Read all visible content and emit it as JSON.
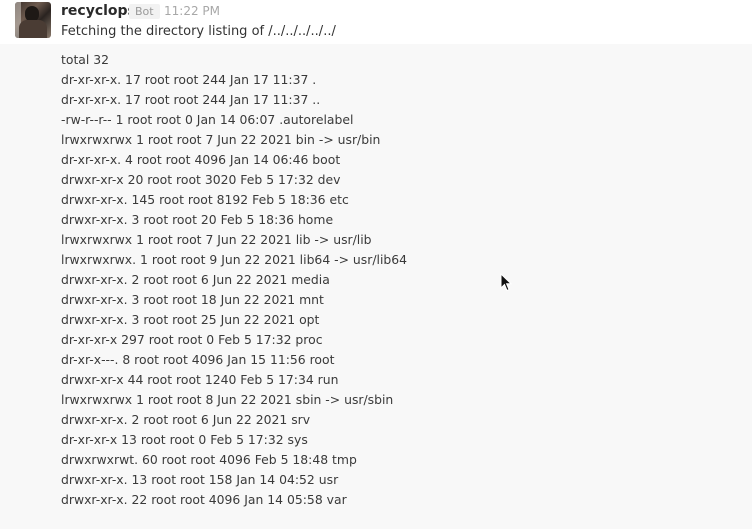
{
  "message": {
    "sender": "recyclops",
    "badge": "Bot",
    "timestamp": "11:22 PM",
    "text": "Fetching the directory listing of /../../../../../",
    "avatar_icon": "avatar-image"
  },
  "listing": [
    "total 32",
    "dr-xr-xr-x. 17 root root 244 Jan 17 11:37 .",
    "dr-xr-xr-x. 17 root root 244 Jan 17 11:37 ..",
    "-rw-r--r-- 1 root root 0 Jan 14 06:07 .autorelabel",
    "lrwxrwxrwx 1 root root 7 Jun 22 2021 bin -> usr/bin",
    "dr-xr-xr-x. 4 root root 4096 Jan 14 06:46 boot",
    "drwxr-xr-x 20 root root 3020 Feb 5 17:32 dev",
    "drwxr-xr-x. 145 root root 8192 Feb 5 18:36 etc",
    "drwxr-xr-x. 3 root root 20 Feb 5 18:36 home",
    "lrwxrwxrwx 1 root root 7 Jun 22 2021 lib -> usr/lib",
    "lrwxrwxrwx. 1 root root 9 Jun 22 2021 lib64 -> usr/lib64",
    "drwxr-xr-x. 2 root root 6 Jun 22 2021 media",
    "drwxr-xr-x. 3 root root 18 Jun 22 2021 mnt",
    "drwxr-xr-x. 3 root root 25 Jun 22 2021 opt",
    "dr-xr-xr-x 297 root root 0 Feb 5 17:32 proc",
    "dr-xr-x---. 8 root root 4096 Jan 15 11:56 root",
    "drwxr-xr-x 44 root root 1240 Feb 5 17:34 run",
    "lrwxrwxrwx 1 root root 8 Jun 22 2021 sbin -> usr/sbin",
    "drwxr-xr-x. 2 root root 6 Jun 22 2021 srv",
    "dr-xr-xr-x 13 root root 0 Feb 5 17:32 sys",
    "drwxrwxrwt. 60 root root 4096 Feb 5 18:48 tmp",
    "drwxr-xr-x. 13 root root 158 Jan 14 04:52 usr",
    "drwxr-xr-x. 22 root root 4096 Jan 14 05:58 var"
  ],
  "colors": {
    "code_background": "#f8f8f8",
    "text": "#333333",
    "timestamp": "#a8a8a8"
  }
}
